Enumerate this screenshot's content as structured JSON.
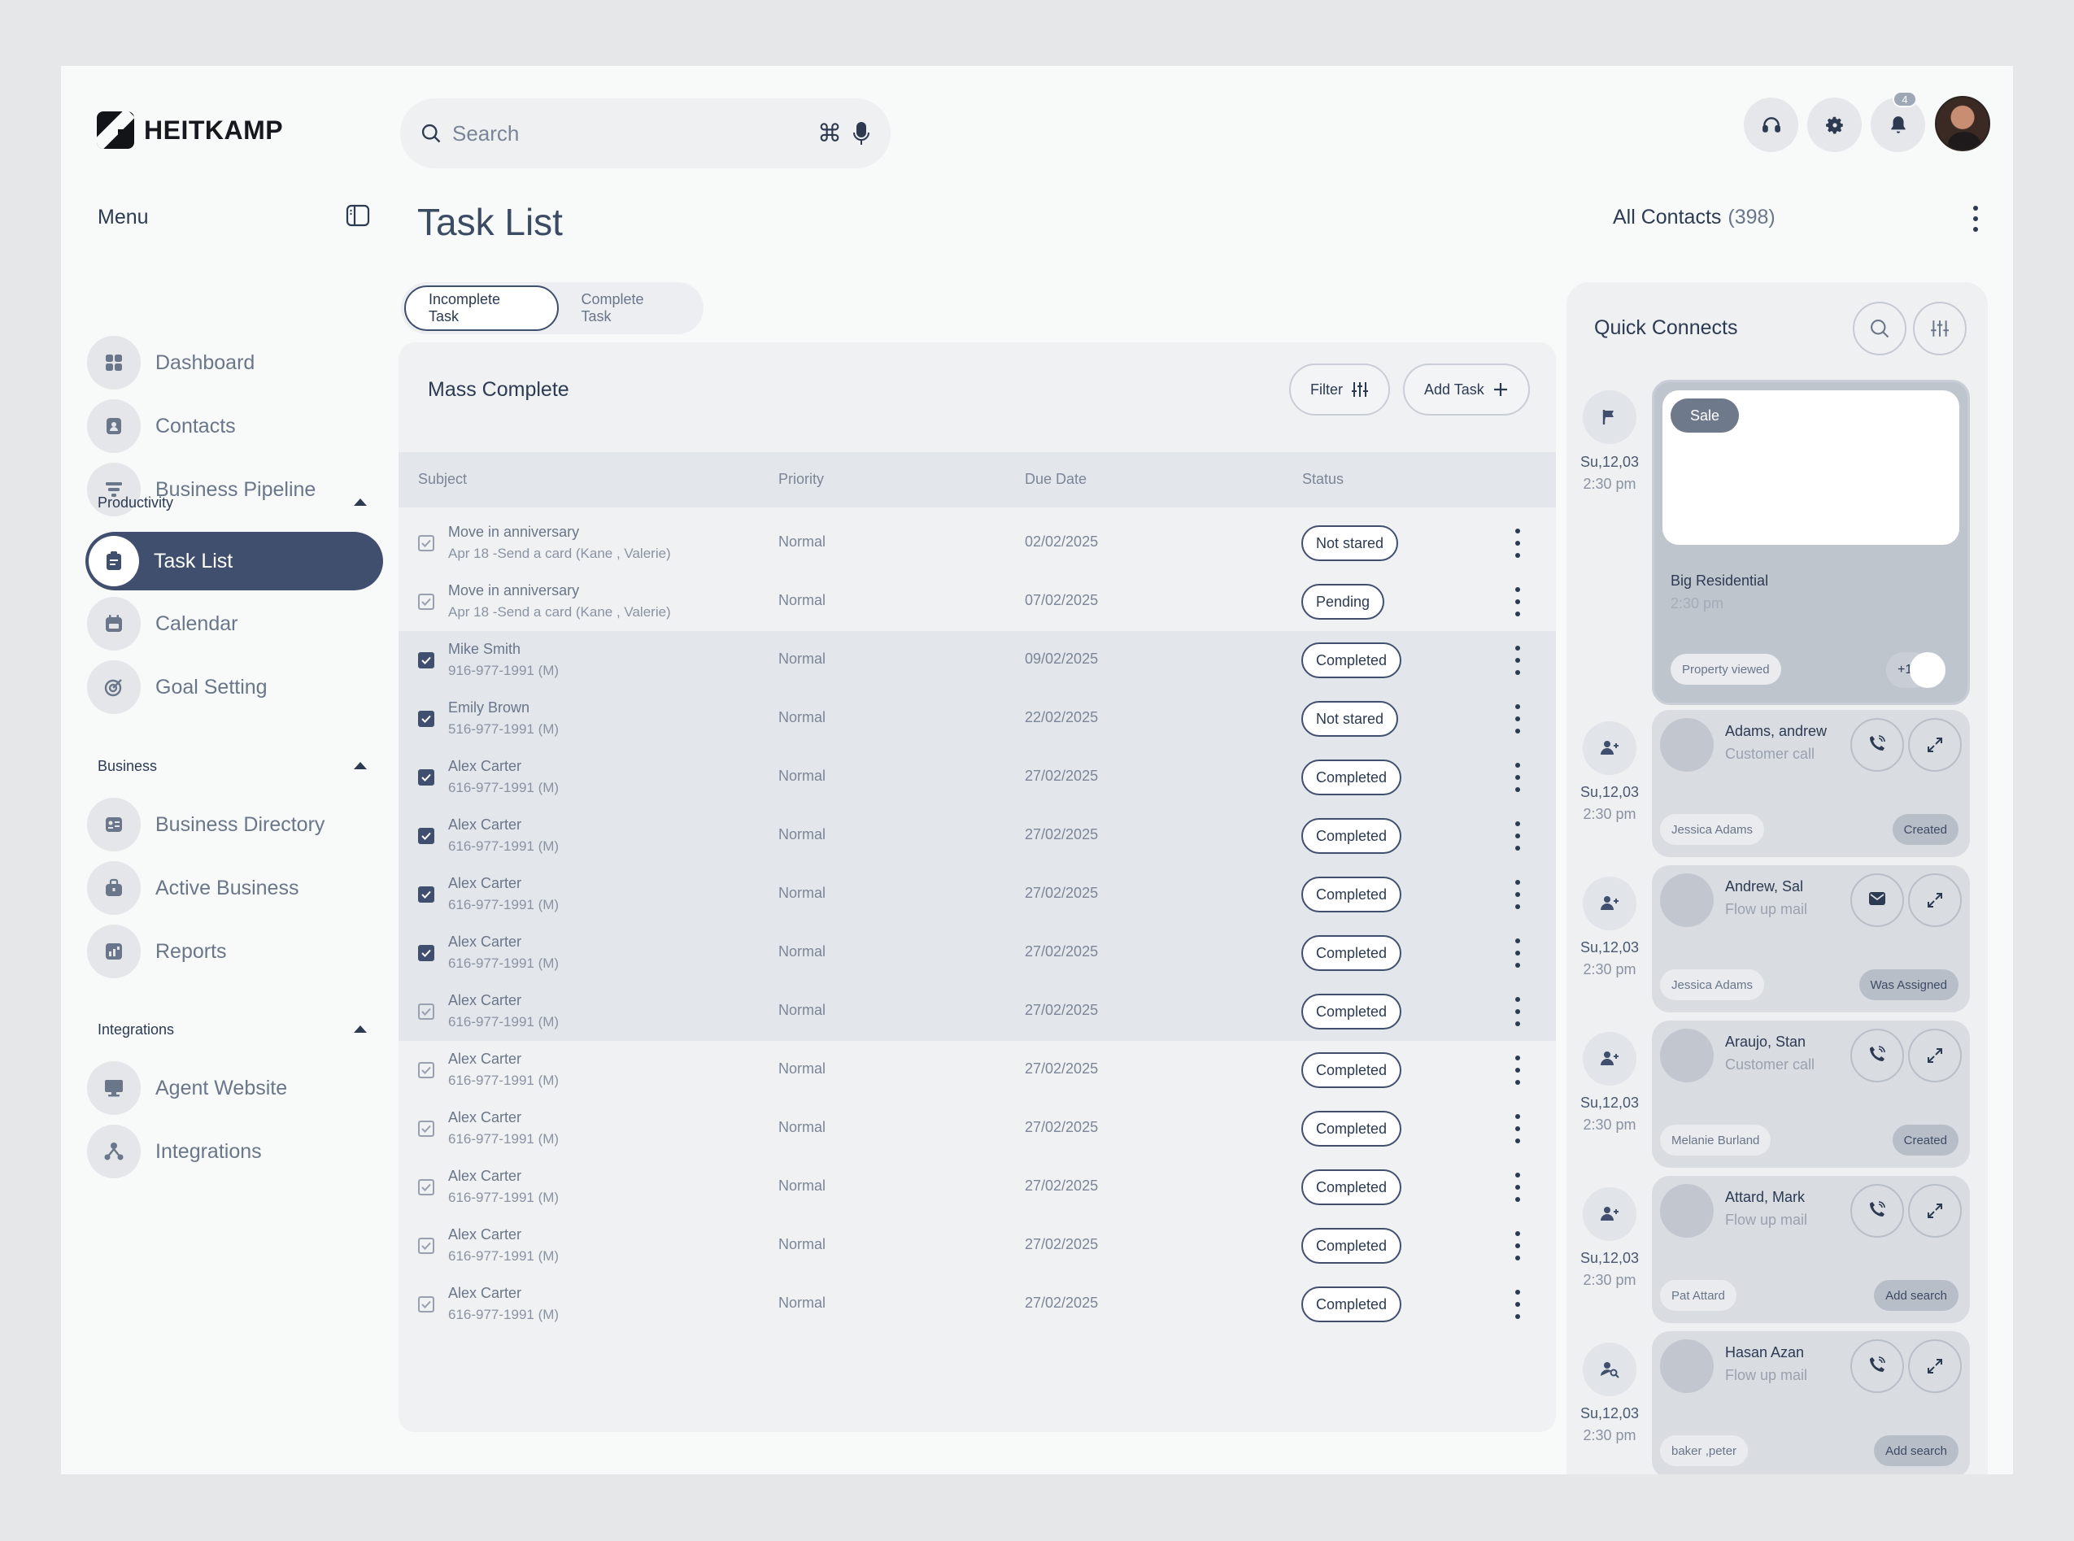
{
  "brand": {
    "name": "HEITKAMP"
  },
  "search": {
    "placeholder": "Search",
    "shortcut": "⌘"
  },
  "header": {
    "notifications_count": "4"
  },
  "sidebar": {
    "menu_title": "Menu",
    "main": [
      {
        "label": "Dashboard",
        "icon": "grid-icon"
      },
      {
        "label": "Contacts",
        "icon": "contact-card-icon"
      },
      {
        "label": "Business Pipeline",
        "icon": "funnel-icon"
      }
    ],
    "productivity": {
      "title": "Productivity",
      "items": [
        {
          "label": "Task List",
          "icon": "clipboard-icon"
        },
        {
          "label": "Calendar",
          "icon": "calendar-icon"
        },
        {
          "label": "Goal Setting",
          "icon": "target-icon"
        }
      ]
    },
    "business": {
      "title": "Business",
      "items": [
        {
          "label": "Business Directory",
          "icon": "id-card-icon"
        },
        {
          "label": "Active Business",
          "icon": "briefcase-icon"
        },
        {
          "label": "Reports",
          "icon": "report-icon"
        }
      ]
    },
    "integrations": {
      "title": "Integrations",
      "items": [
        {
          "label": "Agent Website",
          "icon": "monitor-icon"
        },
        {
          "label": "Integrations",
          "icon": "network-icon"
        }
      ]
    }
  },
  "main": {
    "title": "Task List",
    "tabs": [
      "Incomplete Task",
      "Complete Task"
    ],
    "panel_title": "Mass Complete",
    "filter_label": "Filter",
    "add_task_label": "Add Task",
    "columns": [
      "Subject",
      "Priority",
      "Due Date",
      "Status"
    ],
    "rows": [
      {
        "title": "Move in anniversary",
        "sub": "Apr 18 -Send a card (Kane , Valerie)",
        "priority": "Normal",
        "due": "02/02/2025",
        "status": "Not stared",
        "checked": false,
        "highlight": false
      },
      {
        "title": "Move in anniversary",
        "sub": "Apr 18 -Send a card (Kane , Valerie)",
        "priority": "Normal",
        "due": "07/02/2025",
        "status": "Pending",
        "checked": false,
        "highlight": false
      },
      {
        "title": "Mike Smith",
        "sub": "916-977-1991 (M)",
        "priority": "Normal",
        "due": "09/02/2025",
        "status": "Completed",
        "checked": true,
        "highlight": true
      },
      {
        "title": "Emily Brown",
        "sub": "516-977-1991 (M)",
        "priority": "Normal",
        "due": "22/02/2025",
        "status": "Not stared",
        "checked": true,
        "highlight": true
      },
      {
        "title": "Alex Carter",
        "sub": "616-977-1991 (M)",
        "priority": "Normal",
        "due": "27/02/2025",
        "status": "Completed",
        "checked": true,
        "highlight": true
      },
      {
        "title": "Alex Carter",
        "sub": "616-977-1991 (M)",
        "priority": "Normal",
        "due": "27/02/2025",
        "status": "Completed",
        "checked": true,
        "highlight": true
      },
      {
        "title": "Alex Carter",
        "sub": "616-977-1991 (M)",
        "priority": "Normal",
        "due": "27/02/2025",
        "status": "Completed",
        "checked": true,
        "highlight": true
      },
      {
        "title": "Alex Carter",
        "sub": "616-977-1991 (M)",
        "priority": "Normal",
        "due": "27/02/2025",
        "status": "Completed",
        "checked": true,
        "highlight": true
      },
      {
        "title": "Alex Carter",
        "sub": "616-977-1991 (M)",
        "priority": "Normal",
        "due": "27/02/2025",
        "status": "Completed",
        "checked": false,
        "highlight": true
      },
      {
        "title": "Alex Carter",
        "sub": "616-977-1991 (M)",
        "priority": "Normal",
        "due": "27/02/2025",
        "status": "Completed",
        "checked": false,
        "highlight": false
      },
      {
        "title": "Alex Carter",
        "sub": "616-977-1991 (M)",
        "priority": "Normal",
        "due": "27/02/2025",
        "status": "Completed",
        "checked": false,
        "highlight": false
      },
      {
        "title": "Alex Carter",
        "sub": "616-977-1991 (M)",
        "priority": "Normal",
        "due": "27/02/2025",
        "status": "Completed",
        "checked": false,
        "highlight": false
      },
      {
        "title": "Alex Carter",
        "sub": "616-977-1991 (M)",
        "priority": "Normal",
        "due": "27/02/2025",
        "status": "Completed",
        "checked": false,
        "highlight": false
      },
      {
        "title": "Alex Carter",
        "sub": "616-977-1991 (M)",
        "priority": "Normal",
        "due": "27/02/2025",
        "status": "Completed",
        "checked": false,
        "highlight": false
      }
    ]
  },
  "contacts": {
    "all_label": "All Contacts",
    "count": "(398)",
    "quick_title": "Quick Connects",
    "sale_card": {
      "tag": "Sale",
      "title": "Big Residential",
      "time": "2:30 pm",
      "pill": "Property viewed",
      "more": "+12",
      "date": "Su,12,03",
      "date_time": "2:30 pm",
      "icon": "flag-icon"
    },
    "cards": [
      {
        "name": "Adams, andrew",
        "sub": "Customer call",
        "person": "Jessica Adams",
        "status": "Created",
        "action": "phone-icon",
        "date": "Su,12,03",
        "time": "2:30 pm",
        "icon": "user-add-icon"
      },
      {
        "name": "Andrew, Sal",
        "sub": "Flow up mail",
        "person": "Jessica Adams",
        "status": "Was Assigned",
        "action": "mail-icon",
        "date": "Su,12,03",
        "time": "2:30 pm",
        "icon": "user-add-icon"
      },
      {
        "name": "Araujo, Stan",
        "sub": "Customer call",
        "person": "Melanie Burland",
        "status": "Created",
        "action": "phone-icon",
        "date": "Su,12,03",
        "time": "2:30 pm",
        "icon": "user-add-icon"
      },
      {
        "name": "Attard, Mark",
        "sub": "Flow up mail",
        "person": "Pat Attard",
        "status": "Add search",
        "action": "phone-icon",
        "date": "Su,12,03",
        "time": "2:30 pm",
        "icon": "user-add-icon"
      },
      {
        "name": "Hasan Azan",
        "sub": "Flow up mail",
        "person": "baker ,peter",
        "status": "Add search",
        "action": "phone-icon",
        "date": "Su,12,03",
        "time": "2:30 pm",
        "icon": "user-search-icon"
      }
    ]
  },
  "colors": {
    "primary": "#3f4f6d",
    "background": "#f8f9f9",
    "panel": "#eff1f3"
  }
}
